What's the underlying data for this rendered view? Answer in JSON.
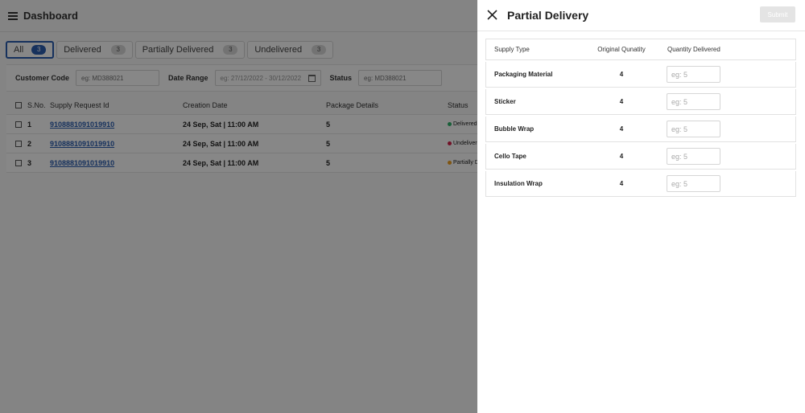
{
  "app": {
    "title": "Dashboard"
  },
  "tabs": [
    {
      "label": "All",
      "count": "3"
    },
    {
      "label": "Delivered",
      "count": "3"
    },
    {
      "label": "Partially Delivered",
      "count": "3"
    },
    {
      "label": "Undelivered",
      "count": "3"
    }
  ],
  "filters": {
    "customer_code": {
      "label": "Customer Code",
      "placeholder": "eg: MD388021"
    },
    "date_range": {
      "label": "Date Range",
      "placeholder": "eg: 27/12/2022 - 30/12/2022"
    },
    "status": {
      "label": "Status",
      "placeholder": "eg: MD388021"
    }
  },
  "table": {
    "headers": {
      "sno": "S.No.",
      "id": "Supply Request Id",
      "date": "Creation Date",
      "package": "Package Details",
      "status": "Status"
    },
    "rows": [
      {
        "sno": "1",
        "id": "9108881091019910",
        "date": "24 Sep, Sat | 11:00 AM",
        "package": "5",
        "status": "Delivered",
        "status_color": "#2fb36a"
      },
      {
        "sno": "2",
        "id": "9108881091019910",
        "date": "24 Sep, Sat | 11:00 AM",
        "package": "5",
        "status": "Undeliver",
        "status_color": "#d6204a"
      },
      {
        "sno": "3",
        "id": "9108881091019910",
        "date": "24 Sep, Sat | 11:00 AM",
        "package": "5",
        "status": "Partially D",
        "status_color": "#f0a020"
      }
    ]
  },
  "drawer": {
    "title": "Partial Delivery",
    "submit_label": "Submit",
    "headers": {
      "type": "Supply Type",
      "original": "Original Qunatity",
      "delivered": "Quantity Delivered"
    },
    "items": [
      {
        "type": "Packaging Material",
        "original": "4",
        "placeholder": "eg: 5"
      },
      {
        "type": "Sticker",
        "original": "4",
        "placeholder": "eg: 5"
      },
      {
        "type": "Bubble Wrap",
        "original": "4",
        "placeholder": "eg: 5"
      },
      {
        "type": "Cello Tape",
        "original": "4",
        "placeholder": "eg: 5"
      },
      {
        "type": "Insulation Wrap",
        "original": "4",
        "placeholder": "eg: 5"
      }
    ]
  },
  "colors": {
    "accent": "#2a5db0",
    "overlay": "rgba(0,0,0,0.47)"
  },
  "icons": {
    "menu": "hamburger-menu-icon",
    "close": "close-icon",
    "calendar": "calendar-icon"
  }
}
